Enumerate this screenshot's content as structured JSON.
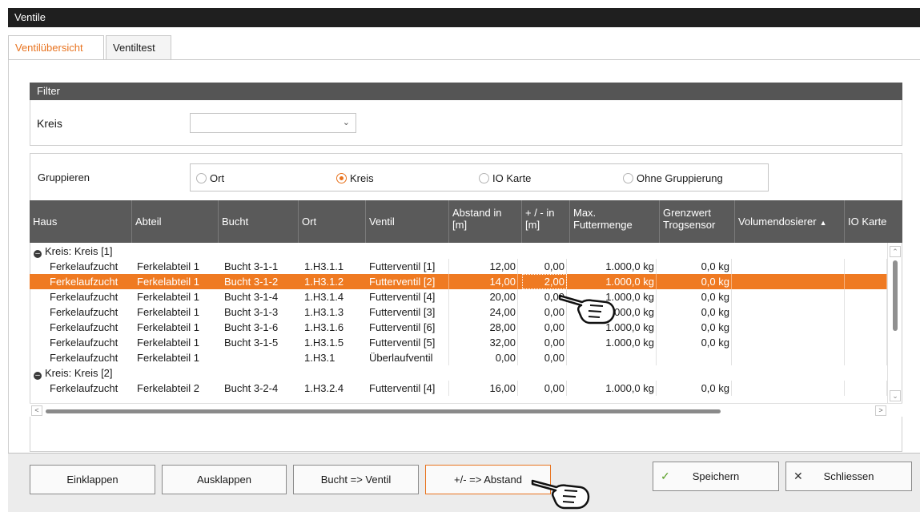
{
  "window": {
    "title": "Ventile"
  },
  "tabs": [
    {
      "label": "Ventilübersicht",
      "active": true
    },
    {
      "label": "Ventiltest",
      "active": false
    }
  ],
  "filter": {
    "header": "Filter",
    "kreis_label": "Kreis",
    "kreis_value": ""
  },
  "grouping": {
    "label": "Gruppieren",
    "options": [
      "Ort",
      "Kreis",
      "IO Karte",
      "Ohne Gruppierung"
    ],
    "selected": "Kreis"
  },
  "table": {
    "columns": [
      {
        "l1": "Haus",
        "l2": ""
      },
      {
        "l1": "Abteil",
        "l2": ""
      },
      {
        "l1": "Bucht",
        "l2": ""
      },
      {
        "l1": "Ort",
        "l2": ""
      },
      {
        "l1": "Ventil",
        "l2": ""
      },
      {
        "l1": "Abstand in",
        "l2": "[m]"
      },
      {
        "l1": "+ / - in",
        "l2": "[m]"
      },
      {
        "l1": "Max.",
        "l2": "Futtermenge"
      },
      {
        "l1": "Grenzwert",
        "l2": "Trogsensor"
      },
      {
        "l1": "Volumendosierer",
        "l2": ""
      },
      {
        "l1": "IO Karte",
        "l2": ""
      }
    ],
    "groups": [
      {
        "label": "Kreis: Kreis [1]",
        "rows": [
          [
            "Ferkelaufzucht",
            "Ferkelabteil 1",
            "Bucht 3-1-1",
            "1.H3.1.1",
            "Futterventil [1]",
            "12,00",
            "0,00",
            "1.000,0 kg",
            "0,0 kg",
            "",
            ""
          ],
          [
            "Ferkelaufzucht",
            "Ferkelabteil 1",
            "Bucht 3-1-2",
            "1.H3.1.2",
            "Futterventil [2]",
            "14,00",
            "2,00",
            "1.000,0 kg",
            "0,0 kg",
            "",
            ""
          ],
          [
            "Ferkelaufzucht",
            "Ferkelabteil 1",
            "Bucht 3-1-4",
            "1.H3.1.4",
            "Futterventil [4]",
            "20,00",
            "0,00",
            "1.000,0 kg",
            "0,0 kg",
            "",
            ""
          ],
          [
            "Ferkelaufzucht",
            "Ferkelabteil 1",
            "Bucht 3-1-3",
            "1.H3.1.3",
            "Futterventil [3]",
            "24,00",
            "0,00",
            "1.000,0 kg",
            "0,0 kg",
            "",
            ""
          ],
          [
            "Ferkelaufzucht",
            "Ferkelabteil 1",
            "Bucht 3-1-6",
            "1.H3.1.6",
            "Futterventil [6]",
            "28,00",
            "0,00",
            "1.000,0 kg",
            "0,0 kg",
            "",
            ""
          ],
          [
            "Ferkelaufzucht",
            "Ferkelabteil 1",
            "Bucht 3-1-5",
            "1.H3.1.5",
            "Futterventil [5]",
            "32,00",
            "0,00",
            "1.000,0 kg",
            "0,0 kg",
            "",
            ""
          ],
          [
            "Ferkelaufzucht",
            "Ferkelabteil 1",
            "",
            "1.H3.1",
            "Überlaufventil",
            "0,00",
            "0,00",
            "",
            "",
            "",
            ""
          ]
        ]
      },
      {
        "label": "Kreis: Kreis [2]",
        "rows": [
          [
            "Ferkelaufzucht",
            "Ferkelabteil 2",
            "Bucht 3-2-4",
            "1.H3.2.4",
            "Futterventil [4]",
            "16,00",
            "0,00",
            "1.000,0 kg",
            "0,0 kg",
            "",
            ""
          ]
        ]
      }
    ],
    "selected_row": "Bucht 3-1-2"
  },
  "buttons": {
    "collapse": "Einklappen",
    "expand": "Ausklappen",
    "pen_to_valve": "Bucht => Ventil",
    "offset_to_distance": "+/- => Abstand",
    "save": "Speichern",
    "close": "Schliessen"
  },
  "colors": {
    "accent": "#ef7a22",
    "header": "#5a5a5a",
    "titlebar": "#1f1f1f",
    "save_check": "#5aa028"
  },
  "icons": [
    "minus-circle-icon",
    "chevron-down-icon",
    "sort-up-icon",
    "check-icon",
    "close-icon",
    "pointing-hand-icon"
  ]
}
